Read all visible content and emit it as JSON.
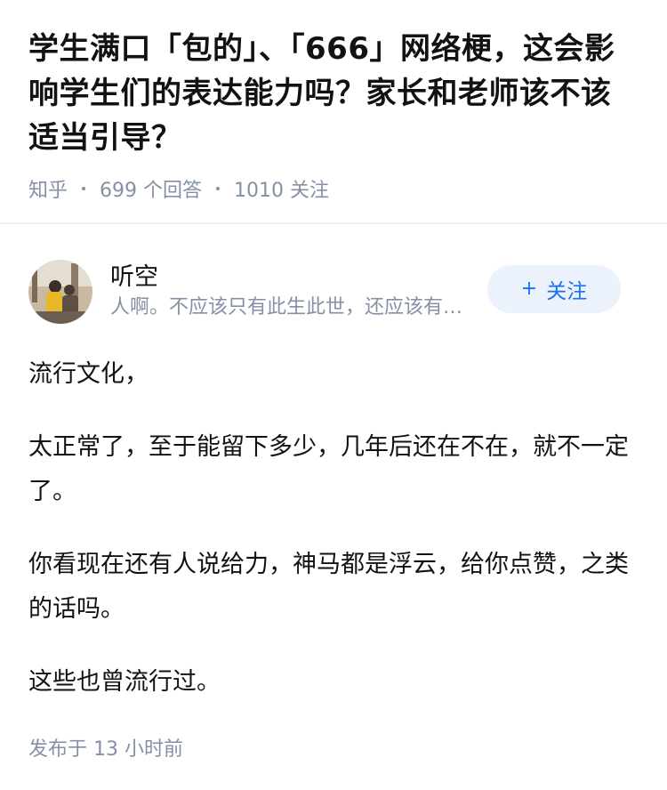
{
  "question": {
    "title": "学生满口「包的」、「666」网络梗，这会影响学生们的表达能力吗？家长和老师该不该适当引导？",
    "source": "知乎",
    "answer_count": "699",
    "answer_label": "个回答",
    "follow_count": "1010",
    "follow_label": "关注"
  },
  "answer": {
    "author": {
      "name": "听空",
      "bio": "人啊。不应该只有此生此世，还应该有诗和远方",
      "follow_button": "关注",
      "follow_icon": "plus-icon"
    },
    "paragraphs": [
      "流行文化，",
      "太正常了，至于能留下多少，几年后还在不在，就不一定了。",
      "你看现在还有人说给力，神马都是浮云，给你点赞，之类的话吗。",
      "这些也曾流行过。"
    ],
    "publish_prefix": "发布于",
    "publish_time": "13 小时前"
  },
  "colors": {
    "meta": "#8590a6",
    "accent": "#1772f6",
    "button_bg": "#ebf2fb"
  }
}
